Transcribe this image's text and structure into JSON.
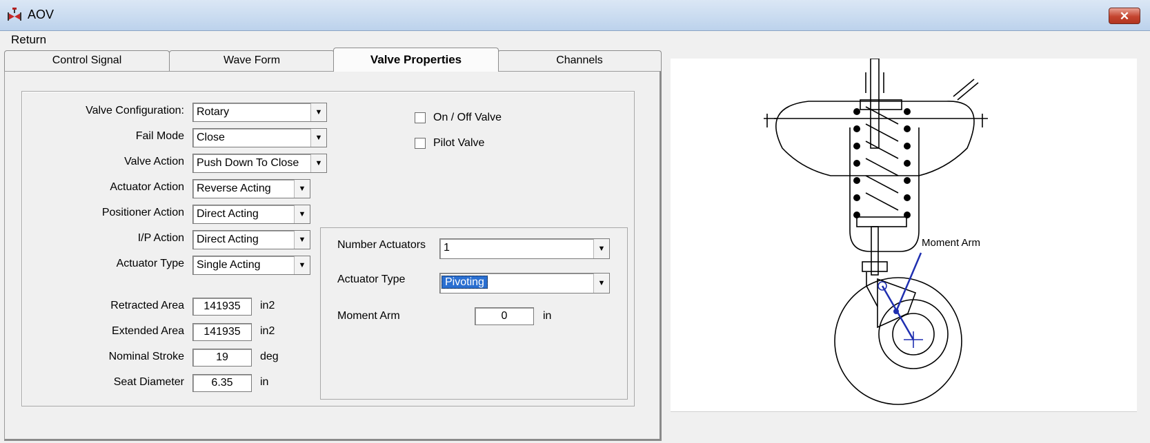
{
  "window": {
    "title": "AOV",
    "close_label": "✕"
  },
  "menu": {
    "return_label": "Return"
  },
  "tabs": [
    {
      "label": "Control Signal",
      "active": false
    },
    {
      "label": "Wave Form",
      "active": false
    },
    {
      "label": "Valve Properties",
      "active": true
    },
    {
      "label": "Channels",
      "active": false
    }
  ],
  "valve": {
    "configuration": {
      "label": "Valve Configuration:",
      "value": "Rotary"
    },
    "fail_mode": {
      "label": "Fail Mode",
      "value": "Close"
    },
    "valve_action": {
      "label": "Valve Action",
      "value": "Push Down To Close"
    },
    "actuator_action": {
      "label": "Actuator Action",
      "value": "Reverse Acting"
    },
    "positioner_action": {
      "label": "Positioner Action",
      "value": "Direct Acting"
    },
    "ip_action": {
      "label": "I/P Action",
      "value": "Direct Acting"
    },
    "actuator_type": {
      "label": "Actuator Type",
      "value": "Single Acting"
    },
    "retracted_area": {
      "label": "Retracted Area",
      "value": "141935",
      "unit": "in2"
    },
    "extended_area": {
      "label": "Extended Area",
      "value": "141935",
      "unit": "in2"
    },
    "nominal_stroke": {
      "label": "Nominal Stroke",
      "value": "19",
      "unit": "deg"
    },
    "seat_diameter": {
      "label": "Seat Diameter",
      "value": "6.35",
      "unit": "in"
    },
    "on_off_valve": {
      "label": "On / Off Valve",
      "checked": false
    },
    "pilot_valve": {
      "label": "Pilot Valve",
      "checked": false
    }
  },
  "actuators": {
    "number": {
      "label": "Number Actuators",
      "value": "1"
    },
    "type": {
      "label": "Actuator Type",
      "value": "Pivoting"
    },
    "moment_arm": {
      "label": "Moment Arm",
      "value": "0",
      "unit": "in"
    }
  },
  "diagram": {
    "annotation": "Moment Arm",
    "arm_color": "#1f2fb0"
  }
}
